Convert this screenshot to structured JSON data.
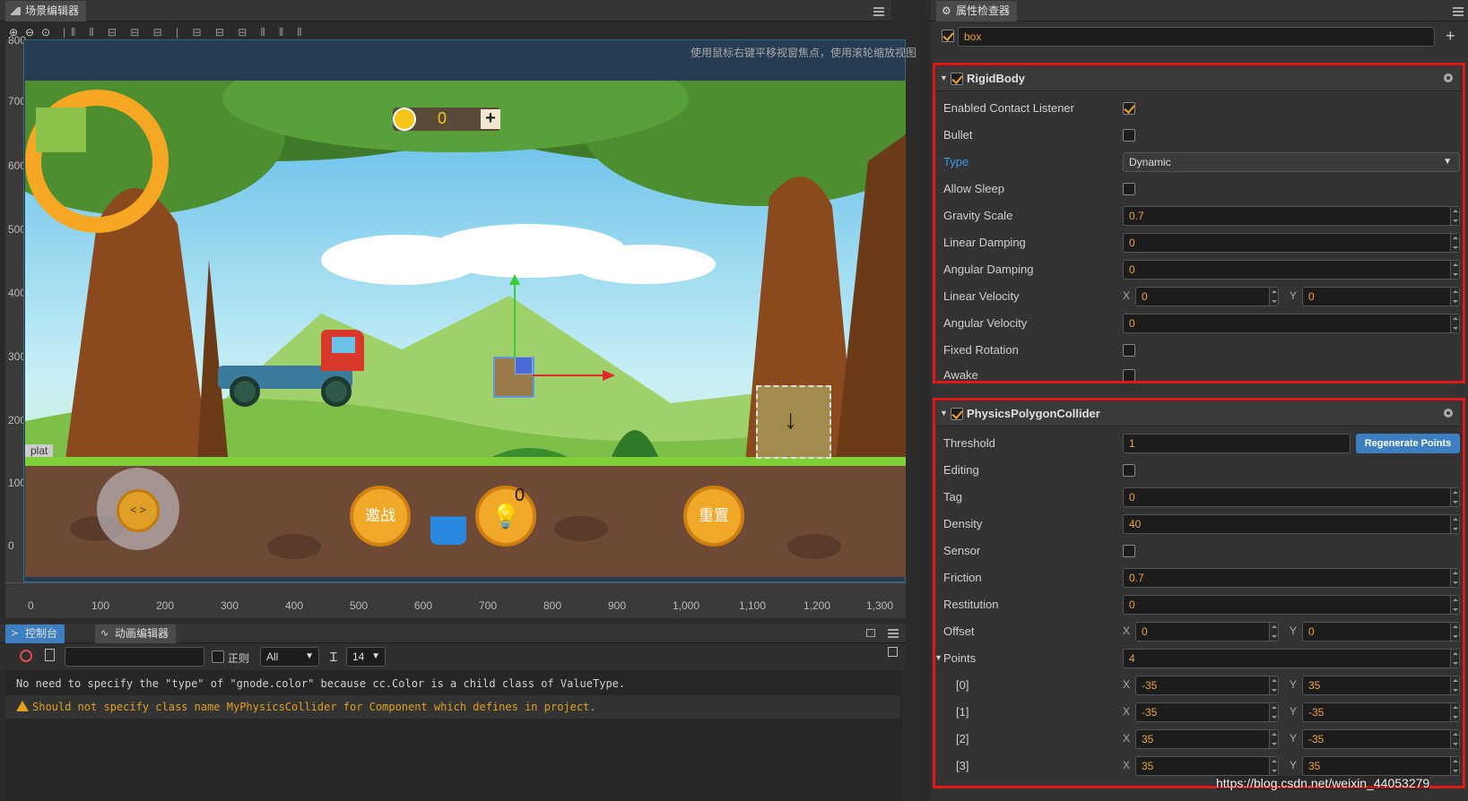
{
  "scene_editor": {
    "tab_label": "场景编辑器",
    "hint": "使用鼠标右键平移视窗焦点，使用滚轮缩放视图",
    "ruler_x": [
      "0",
      "100",
      "200",
      "300",
      "400",
      "500",
      "600",
      "700",
      "800",
      "900",
      "1,000",
      "1,100",
      "1,200",
      "1,300"
    ],
    "ruler_y": [
      "800",
      "700",
      "600",
      "500",
      "400",
      "300",
      "200",
      "100",
      "0"
    ],
    "game": {
      "score": "0",
      "plat_label": "plat",
      "btn_challenge": "邀战",
      "btn_reset": "重置",
      "hint_count": "0"
    }
  },
  "console": {
    "tab_label": "控制台",
    "anim_tab_label": "动画编辑器",
    "regex_label": "正则",
    "filter_value": "All",
    "font_size": "14",
    "lines": [
      {
        "level": "log",
        "text": "No need to specify the \"type\" of \"gnode.color\" because cc.Color is a child class of ValueType."
      },
      {
        "level": "warn",
        "text": "Should not specify class name MyPhysicsCollider for Component which defines in project."
      }
    ]
  },
  "inspector": {
    "tab_label": "属性检查器",
    "node_name": "box",
    "rigidbody": {
      "title": "RigidBody",
      "enabled_contact_listener": {
        "label": "Enabled Contact Listener",
        "checked": true
      },
      "bullet": {
        "label": "Bullet",
        "checked": false
      },
      "type": {
        "label": "Type",
        "value": "Dynamic"
      },
      "allow_sleep": {
        "label": "Allow Sleep",
        "checked": false
      },
      "gravity_scale": {
        "label": "Gravity Scale",
        "value": "0.7"
      },
      "linear_damping": {
        "label": "Linear Damping",
        "value": "0"
      },
      "angular_damping": {
        "label": "Angular Damping",
        "value": "0"
      },
      "linear_velocity": {
        "label": "Linear Velocity",
        "x": "0",
        "y": "0"
      },
      "angular_velocity": {
        "label": "Angular Velocity",
        "value": "0"
      },
      "fixed_rotation": {
        "label": "Fixed Rotation",
        "checked": false
      },
      "awake": {
        "label": "Awake",
        "checked": false
      }
    },
    "collider": {
      "title": "PhysicsPolygonCollider",
      "threshold": {
        "label": "Threshold",
        "value": "1"
      },
      "regenerate_label": "Regenerate Points",
      "editing": {
        "label": "Editing",
        "checked": false
      },
      "tag": {
        "label": "Tag",
        "value": "0"
      },
      "density": {
        "label": "Density",
        "value": "40"
      },
      "sensor": {
        "label": "Sensor",
        "checked": false
      },
      "friction": {
        "label": "Friction",
        "value": "0.7"
      },
      "restitution": {
        "label": "Restitution",
        "value": "0"
      },
      "offset": {
        "label": "Offset",
        "x": "0",
        "y": "0"
      },
      "points": {
        "label": "Points",
        "count": "4",
        "items": [
          {
            "label": "[0]",
            "x": "-35",
            "y": "35"
          },
          {
            "label": "[1]",
            "x": "-35",
            "y": "-35"
          },
          {
            "label": "[2]",
            "x": "35",
            "y": "-35"
          },
          {
            "label": "[3]",
            "x": "35",
            "y": "35"
          }
        ]
      }
    },
    "x_label": "X",
    "y_label": "Y"
  },
  "watermark": "https://blog.csdn.net/weixin_44053279",
  "colors": {
    "accent": "#f0a030",
    "highlight_red": "#e01818",
    "button_blue": "#3d7fc1",
    "type_label": "#3d9be9"
  }
}
